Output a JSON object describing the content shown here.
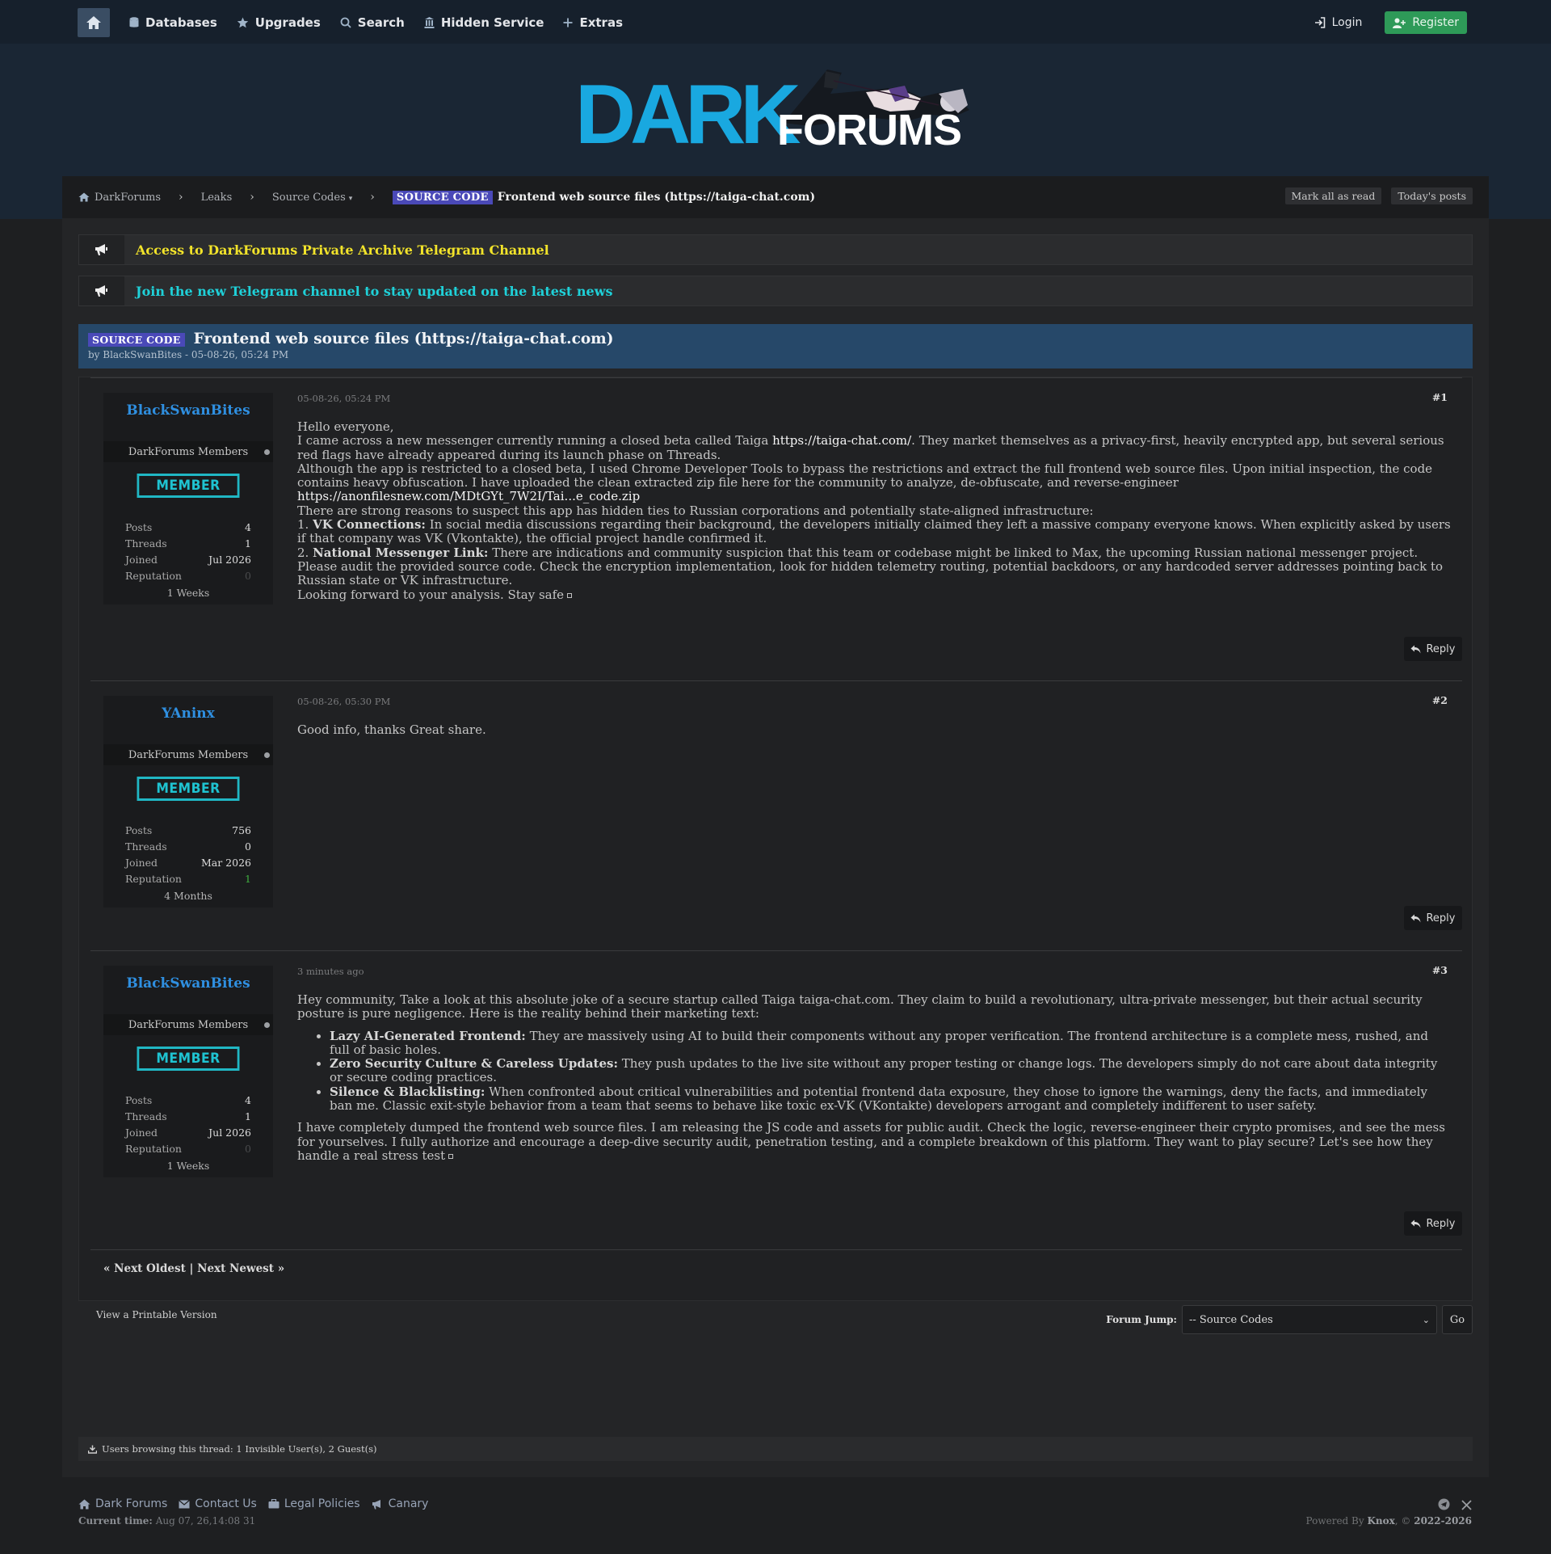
{
  "nav": {
    "items": [
      {
        "label": "Databases",
        "icon": "database-icon"
      },
      {
        "label": "Upgrades",
        "icon": "star-icon"
      },
      {
        "label": "Search",
        "icon": "search-icon"
      },
      {
        "label": "Hidden Service",
        "icon": "onion-icon"
      },
      {
        "label": "Extras",
        "icon": "plus-icon"
      }
    ],
    "login": "Login",
    "register": "Register"
  },
  "logo": {
    "dark": "DARK",
    "forums": "FORUMS"
  },
  "breadcrumb": {
    "items": [
      "DarkForums",
      "Leaks",
      "Source Codes"
    ],
    "prefix": "SOURCE CODE",
    "current": "Frontend web source files (https://taiga-chat.com)",
    "mark_read": "Mark all as read",
    "todays_posts": "Today's posts"
  },
  "announcements": [
    {
      "text": "Access to DarkForums Private Archive Telegram Channel",
      "color": "#f2e32a"
    },
    {
      "text": "Join the new Telegram channel to stay updated on the latest news",
      "color": "#1fd0d8"
    }
  ],
  "thread": {
    "prefix": "SOURCE CODE",
    "title": "Frontend web source files (https://taiga-chat.com)",
    "byline": "by BlackSwanBites - 05-08-26, 05:24 PM"
  },
  "posts": [
    {
      "username": "BlackSwanBites",
      "group": "DarkForums Members",
      "badge": "MEMBER",
      "stats": {
        "posts_label": "Posts",
        "posts": "4",
        "threads_label": "Threads",
        "threads": "1",
        "joined_label": "Joined",
        "joined": "Jul 2026",
        "rep_label": "Reputation",
        "rep": "0"
      },
      "since": "1 Weeks",
      "date": "05-08-26, 05:24 PM",
      "num": "#1",
      "body": {
        "l1": "Hello everyone,",
        "l2a": "I came across a new messenger currently running a closed beta called Taiga ",
        "l2link": "https://taiga-chat.com/",
        "l2b": ". They market themselves as a privacy-first, heavily encrypted app, but several serious red flags have already appeared during its launch phase on Threads.",
        "l3": "Although the app is restricted to a closed beta, I used Chrome Developer Tools to bypass the restrictions and extract the full frontend web source files. Upon initial inspection, the code contains heavy obfuscation. I have uploaded the clean extracted zip file here for the community to analyze, de-obfuscate, and reverse-engineer",
        "l3link": "https://anonfilesnew.com/MDtGYt_7W2I/Tai...e_code.zip",
        "l4": "There are strong reasons to suspect this app has hidden ties to Russian corporations and potentially state-aligned infrastructure:",
        "l5n": "1. ",
        "l5b": "VK Connections:",
        "l5": " In social media discussions regarding their background, the developers initially claimed they left a massive company everyone knows. When explicitly asked by users if that company was VK (Vkontakte), the official project handle confirmed it.",
        "l6n": "2. ",
        "l6b": "National Messenger Link:",
        "l6": " There are indications and community suspicion that this team or codebase might be linked to Max, the upcoming Russian national messenger project.",
        "l7": "Please audit the provided source code. Check the encryption implementation, look for hidden telemetry routing, potential backdoors, or any hardcoded server addresses pointing back to Russian state or VK infrastructure.",
        "l8": "Looking forward to your analysis. Stay safe"
      },
      "reply": "Reply"
    },
    {
      "username": "YAninx",
      "group": "DarkForums Members",
      "badge": "MEMBER",
      "stats": {
        "posts_label": "Posts",
        "posts": "756",
        "threads_label": "Threads",
        "threads": "0",
        "joined_label": "Joined",
        "joined": "Mar 2026",
        "rep_label": "Reputation",
        "rep": "1"
      },
      "since": "4 Months",
      "date": "05-08-26, 05:30 PM",
      "num": "#2",
      "body": {
        "l1": "Good info, thanks Great share."
      },
      "reply": "Reply"
    },
    {
      "username": "BlackSwanBites",
      "group": "DarkForums Members",
      "badge": "MEMBER",
      "stats": {
        "posts_label": "Posts",
        "posts": "4",
        "threads_label": "Threads",
        "threads": "1",
        "joined_label": "Joined",
        "joined": "Jul 2026",
        "rep_label": "Reputation",
        "rep": "0"
      },
      "since": "1 Weeks",
      "date": "3 minutes ago",
      "num": "#3",
      "body": {
        "intro": "Hey community, Take a look at this absolute joke of a secure startup called Taiga taiga-chat.com. They claim to build a revolutionary, ultra-private messenger, but their actual security posture is pure negligence. Here is the reality behind their marketing text:",
        "b1h": "Lazy AI-Generated Frontend:",
        "b1": " They are massively using AI to build their components without any proper verification. The frontend architecture is a complete mess, rushed, and full of basic holes.",
        "b2h": "Zero Security Culture & Careless Updates:",
        "b2": " They push updates to the live site without any proper testing or change logs. The developers simply do not care about data integrity or secure coding practices.",
        "b3h": "Silence & Blacklisting:",
        "b3": " When confronted about critical vulnerabilities and potential frontend data exposure, they chose to ignore the warnings, deny the facts, and immediately ban me. Classic exit-style behavior from a team that seems to behave like toxic ex-VK (VKontakte) developers arrogant and completely indifferent to user safety.",
        "outro": "I have completely dumped the frontend web source files. I am releasing the JS code and assets for public audit. Check the logic, reverse-engineer their crypto promises, and see the mess for yourselves. I fully authorize and encourage a deep-dive security audit, penetration testing, and a complete breakdown of this platform. They want to play secure? Let's see how they handle a real stress test"
      },
      "reply": "Reply"
    }
  ],
  "pagination": "« Next Oldest | Next Newest »",
  "printable": "View a Printable Version",
  "forum_jump": {
    "label": "Forum Jump:",
    "selected": "-- Source Codes",
    "go": "Go"
  },
  "browsing": "Users browsing this thread: 1 Invisible User(s), 2 Guest(s)",
  "footer": {
    "links": [
      "Dark Forums",
      "Contact Us",
      "Legal Policies",
      "Canary"
    ],
    "time_label": "Current time:",
    "time": "Aug 07, 26,14:08 31",
    "powered_prefix": "Powered By ",
    "powered_by": "Knox",
    "copyright_prefix": ", © ",
    "copyright": "2022-2026"
  }
}
